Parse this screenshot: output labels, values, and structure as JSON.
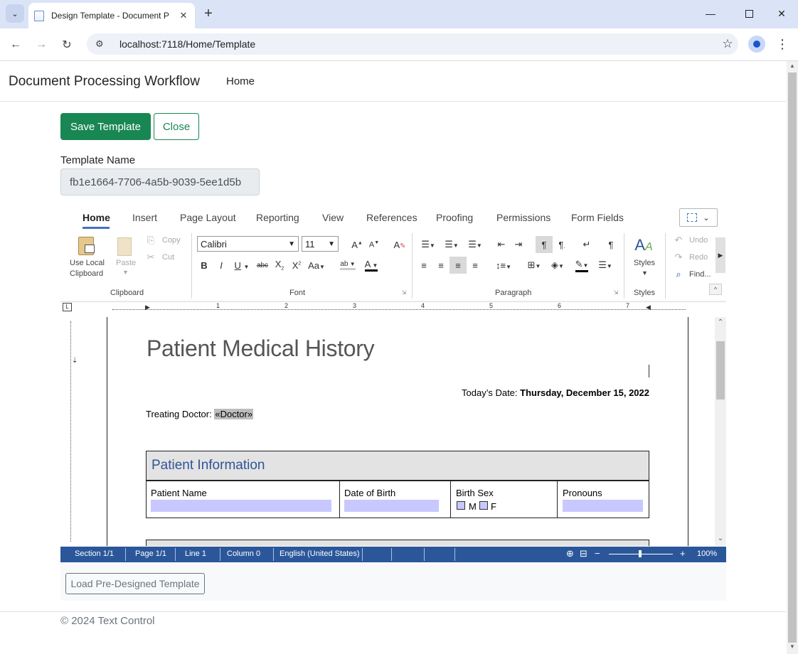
{
  "browser": {
    "tab_title": "Design Template - Document P",
    "url": "localhost:7118/Home/Template"
  },
  "navbar": {
    "brand": "Document Processing Workflow",
    "home": "Home"
  },
  "actions": {
    "save": "Save Template",
    "close": "Close"
  },
  "template": {
    "label": "Template Name",
    "value": "fb1e1664-7706-4a5b-9039-5ee1d5b"
  },
  "ribbon": {
    "tabs": [
      "Home",
      "Insert",
      "Page Layout",
      "Reporting",
      "View",
      "References",
      "Proofing",
      "Permissions",
      "Form Fields"
    ],
    "clipboard": {
      "use_local": "Use Local",
      "clipboard_word": "Clipboard",
      "paste": "Paste",
      "copy": "Copy",
      "cut": "Cut",
      "group": "Clipboard"
    },
    "font": {
      "family": "Calibri",
      "size": "11",
      "group": "Font"
    },
    "paragraph": {
      "group": "Paragraph"
    },
    "styles": {
      "label": "Styles",
      "group": "Styles"
    },
    "editing": {
      "undo": "Undo",
      "redo": "Redo",
      "find": "Find..."
    }
  },
  "ruler": {
    "numbers": [
      "1",
      "2",
      "3",
      "4",
      "5",
      "6",
      "7"
    ]
  },
  "document": {
    "title": "Patient Medical History",
    "date_label": "Today’s Date: ",
    "date_value": "Thursday, December 15, 2022",
    "doctor_label": "Treating Doctor: ",
    "doctor_field": "«Doctor»",
    "patient_info": {
      "title": "Patient Information",
      "name_label": "Patient Name",
      "dob_label": "Date of Birth",
      "sex_label": "Birth Sex",
      "sex_m": "M",
      "sex_f": "F",
      "pronouns_label": "Pronouns"
    }
  },
  "status": {
    "section": "Section 1/1",
    "page": "Page 1/1",
    "line": "Line 1",
    "column": "Column 0",
    "language": "English (United States)",
    "zoom": "100%"
  },
  "load_button": "Load Pre-Designed Template",
  "footer": "© 2024 Text Control"
}
